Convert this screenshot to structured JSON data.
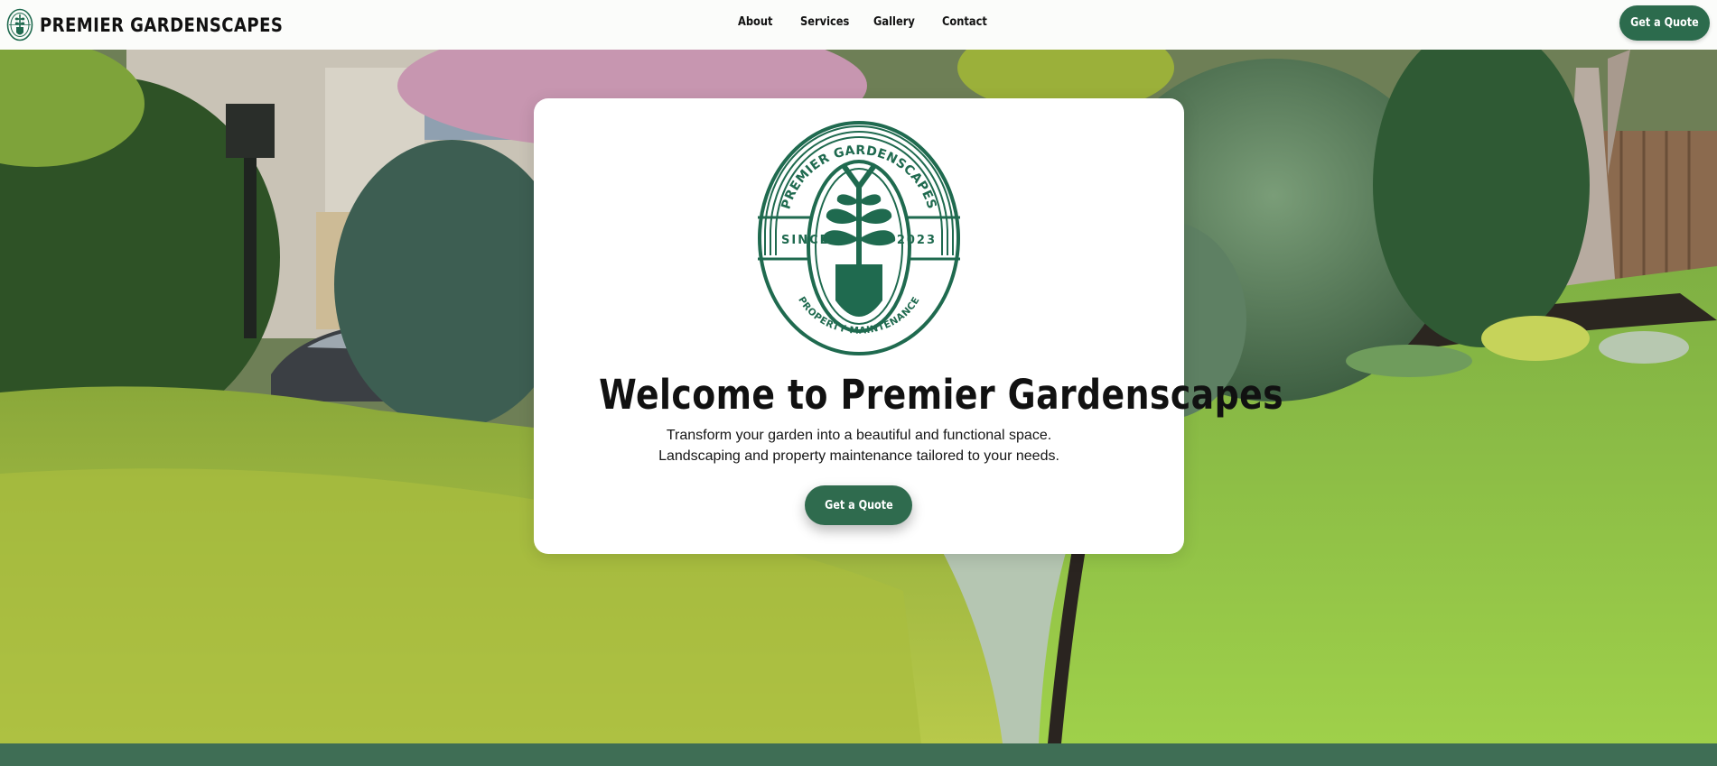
{
  "header": {
    "brand_name": "PREMIER GARDENSCAPES",
    "nav": {
      "about": "About",
      "services": "Services",
      "gallery": "Gallery",
      "contact": "Contact"
    },
    "cta_label": "Get a Quote"
  },
  "hero": {
    "background_image": "landscaped-front-garden-photo",
    "card": {
      "logo": {
        "top_text": "PREMIER GARDENSCAPES",
        "left_text": "SINCE",
        "right_text": "2023",
        "bottom_text": "PROPERTY MAINTENANCE",
        "icon": "shovel-with-plant-icon"
      },
      "title": "Welcome to Premier Gardenscapes",
      "line1": "Transform your garden into a beautiful and functional space.",
      "line2": "Landscaping and property maintenance tailored to your needs.",
      "cta_label": "Get a Quote"
    }
  },
  "colors": {
    "brand_green": "#1f6a4f",
    "button_green": "#2f6b4e",
    "footer_band": "#3f6e55"
  }
}
